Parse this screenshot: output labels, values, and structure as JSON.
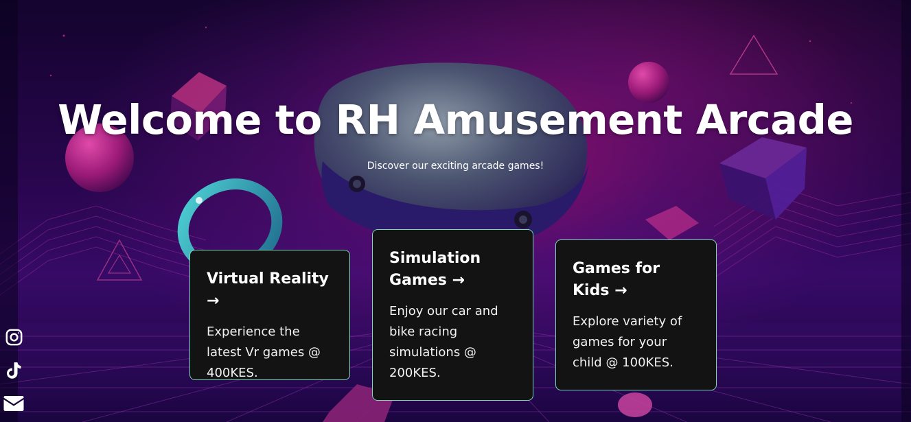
{
  "hero": {
    "title": "Welcome to RH Amusement Arcade",
    "subtitle": "Discover our exciting arcade games!"
  },
  "cards": [
    {
      "title": "Virtual Reality →",
      "text": "Experience the latest Vr games @ 400KES."
    },
    {
      "title": "Simulation Games →",
      "text": "Enjoy our car and bike racing simulations @ 200KES."
    },
    {
      "title": "Games for Kids →",
      "text": "Explore variety of games for your child @ 100KES."
    }
  ],
  "social": [
    {
      "icon": "instagram-icon"
    },
    {
      "icon": "tiktok-icon"
    },
    {
      "icon": "email-icon"
    }
  ],
  "colors": {
    "card_background": "#131313",
    "card_border": "#7fd6b8",
    "text": "#ffffff",
    "accent_magenta": "#c4168a",
    "background_purple": "#2a0650"
  }
}
